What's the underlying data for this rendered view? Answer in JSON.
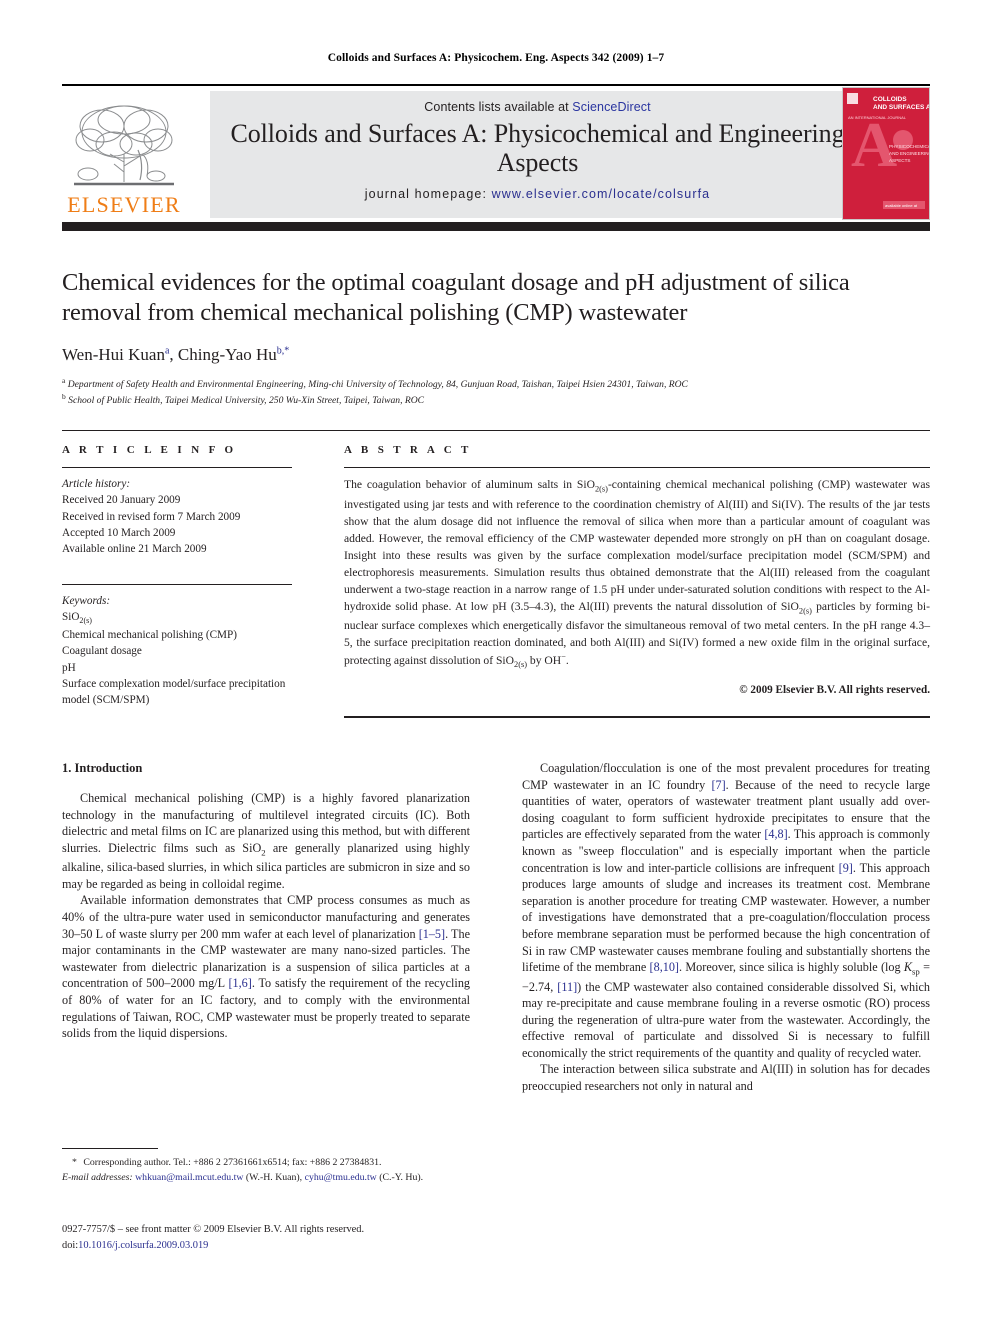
{
  "running_head": "Colloids and Surfaces A: Physicochem. Eng. Aspects 342 (2009) 1–7",
  "masthead": {
    "publisher_name": "ELSEVIER",
    "publisher_color": "#ef7d16",
    "contents_prefix": "Contents lists available at ",
    "contents_link": "ScienceDirect",
    "journal_title": "Colloids and Surfaces A: Physicochemical and Engineering Aspects",
    "homepage_prefix": "journal homepage: ",
    "homepage_url": "www.elsevier.com/locate/colsurfa",
    "link_color": "#2a2f8f",
    "panel_color": "#e6e7e8",
    "cover": {
      "brand": "COLLOIDS AND SURFACES A",
      "letter": "A",
      "subtitle": "PHYSICOCHEMICAL AND ENGINEERING ASPECTS",
      "color": "#cf1f3c"
    }
  },
  "article": {
    "title": "Chemical evidences for the optimal coagulant dosage and pH adjustment of silica removal from chemical mechanical polishing (CMP) wastewater",
    "authors": [
      {
        "name": "Wen-Hui Kuan",
        "mark": "a"
      },
      {
        "name": "Ching-Yao Hu",
        "mark": "b,*"
      }
    ],
    "affiliations": [
      {
        "mark": "a",
        "text": "Department of Safety Health and Environmental Engineering, Ming-chi University of Technology, 84, Gunjuan Road, Taishan, Taipei Hsien 24301, Taiwan, ROC"
      },
      {
        "mark": "b",
        "text": "School of Public Health, Taipei Medical University, 250 Wu-Xin Street, Taipei, Taiwan, ROC"
      }
    ]
  },
  "article_info": {
    "heading": "A R T I C L E   I N F O",
    "history_label": "Article history:",
    "history": [
      "Received 20 January 2009",
      "Received in revised form 7 March 2009",
      "Accepted 10 March 2009",
      "Available online 21 March 2009"
    ],
    "keywords_label": "Keywords:",
    "keywords": [
      "SiO2(s)",
      "Chemical mechanical polishing (CMP)",
      "Coagulant dosage",
      "pH",
      "Surface complexation model/surface precipitation model (SCM/SPM)"
    ]
  },
  "abstract": {
    "heading": "A B S T R A C T",
    "text": "The coagulation behavior of aluminum salts in SiO2(s)-containing chemical mechanical polishing (CMP) wastewater was investigated using jar tests and with reference to the coordination chemistry of Al(III) and Si(IV). The results of the jar tests show that the alum dosage did not influence the removal of silica when more than a particular amount of coagulant was added. However, the removal efficiency of the CMP wastewater depended more strongly on pH than on coagulant dosage. Insight into these results was given by the surface complexation model/surface precipitation model (SCM/SPM) and electrophoresis measurements. Simulation results thus obtained demonstrate that the Al(III) released from the coagulant underwent a two-stage reaction in a narrow range of 1.5 pH under under-saturated solution conditions with respect to the Al-hydroxide solid phase. At low pH (3.5–4.3), the Al(III) prevents the natural dissolution of SiO2(s) particles by forming bi-nuclear surface complexes which energetically disfavor the simultaneous removal of two metal centers. In the pH range 4.3–5, the surface precipitation reaction dominated, and both Al(III) and Si(IV) formed a new oxide film in the original surface, protecting against dissolution of SiO2(s) by OH−.",
    "copyright": "© 2009 Elsevier B.V. All rights reserved."
  },
  "body": {
    "section_number_title": "1.  Introduction",
    "left_paragraphs": [
      "Chemical mechanical polishing (CMP) is a highly favored planarization technology in the manufacturing of multilevel integrated circuits (IC). Both dielectric and metal films on IC are planarized using this method, but with different slurries. Dielectric films such as SiO2 are generally planarized using highly alkaline, silica-based slurries, in which silica particles are submicron in size and so may be regarded as being in colloidal regime.",
      "Available information demonstrates that CMP process consumes as much as 40% of the ultra-pure water used in semiconductor manufacturing and generates 30–50 L of waste slurry per 200 mm wafer at each level of planarization [1–5]. The major contaminants in the CMP wastewater are many nano-sized particles. The wastewater from dielectric planarization is a suspension of silica particles at a concentration of 500–2000 mg/L [1,6]. To satisfy the requirement of the recycling of 80% of water for an IC factory, and to comply with the environmental regulations of Taiwan, ROC, CMP wastewater must be properly treated to separate solids from the liquid dispersions."
    ],
    "right_paragraphs": [
      "Coagulation/flocculation is one of the most prevalent procedures for treating CMP wastewater in an IC foundry [7]. Because of the need to recycle large quantities of water, operators of wastewater treatment plant usually add over-dosing coagulant to form sufficient hydroxide precipitates to ensure that the particles are effectively separated from the water [4,8]. This approach is commonly known as \"sweep flocculation\" and is especially important when the particle concentration is low and inter-particle collisions are infrequent [9]. This approach produces large amounts of sludge and increases its treatment cost. Membrane separation is another procedure for treating CMP wastewater. However, a number of investigations have demonstrated that a pre-coagulation/flocculation process before membrane separation must be performed because the high concentration of Si in raw CMP wastewater causes membrane fouling and substantially shortens the lifetime of the membrane [8,10]. Moreover, since silica is highly soluble (log Ksp = −2.74, [11]) the CMP wastewater also contained considerable dissolved Si, which may re-precipitate and cause membrane fouling in a reverse osmotic (RO) process during the regeneration of ultra-pure water from the wastewater. Accordingly, the effective removal of particulate and dissolved Si is necessary to fulfill economically the strict requirements of the quantity and quality of recycled water.",
      "The interaction between silica substrate and Al(III) in solution has for decades preoccupied researchers not only in natural and"
    ]
  },
  "footnote": {
    "star": "*",
    "corresponding": "Corresponding author. Tel.: +886 2 27361661x6514; fax: +886 2 27384831.",
    "email_label": "E-mail addresses:",
    "email1": "whkuan@mail.mcut.edu.tw",
    "email1_owner": "(W.-H. Kuan),",
    "email2": "cyhu@tmu.edu.tw",
    "email2_owner": "(C.-Y. Hu)."
  },
  "imprint": {
    "issn_line": "0927-7757/$ – see front matter © 2009 Elsevier B.V. All rights reserved.",
    "doi_label": "doi:",
    "doi_value": "10.1016/j.colsurfa.2009.03.019"
  }
}
